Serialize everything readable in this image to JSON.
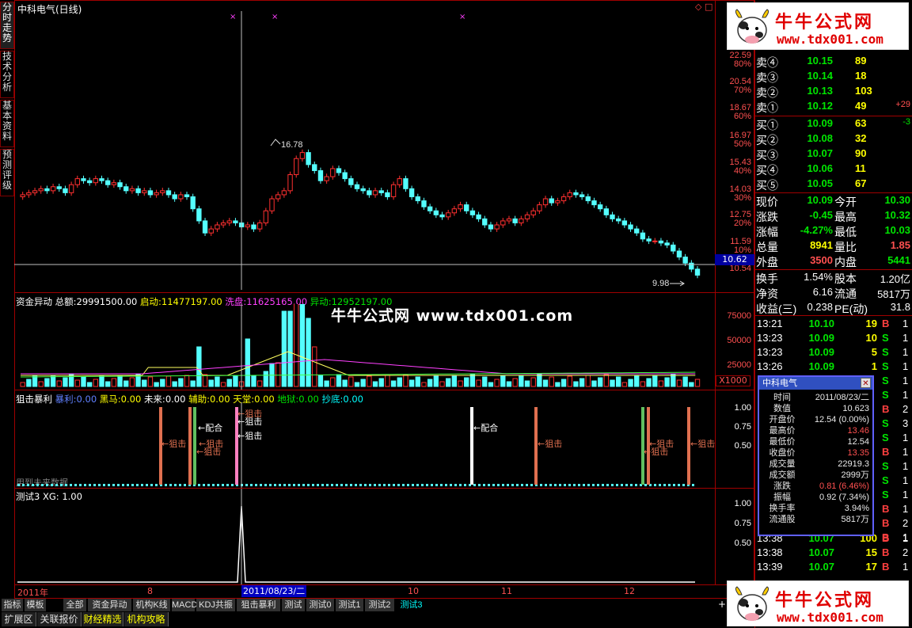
{
  "vertical_tabs": [
    "分时走势",
    "技术分析",
    "基本资料",
    "预测评级"
  ],
  "main_chart": {
    "title": "中科电气(日线)",
    "price_axis": [
      {
        "price": "22.59",
        "pct": "80%"
      },
      {
        "price": "20.54",
        "pct": "70%"
      },
      {
        "price": "18.67",
        "pct": "60%"
      },
      {
        "price": "16.97",
        "pct": "50%"
      },
      {
        "price": "15.43",
        "pct": "40%"
      },
      {
        "price": "14.03",
        "pct": "30%"
      },
      {
        "price": "12.75",
        "pct": "20%"
      },
      {
        "price": "11.59",
        "pct": "10%"
      },
      {
        "price": "10.54",
        "pct": ""
      }
    ],
    "current_price_tag": "10.62",
    "high_marker": "16.78",
    "low_marker": "9.98"
  },
  "watermark": "牛牛公式网 www.tdx001.com",
  "funds_panel": {
    "title": "资金异动",
    "total_label": "总额:",
    "total_value": "29991500.00",
    "start_label": "启动:",
    "start_value": "11477197.00",
    "wash_label": "洗盘:",
    "wash_value": "11625165.00",
    "abnormal_label": "异动:",
    "abnormal_value": "12952197.00",
    "axis": [
      "75000",
      "50000",
      "25000"
    ],
    "unit_tag": "X1000"
  },
  "snipe_panel": {
    "title": "狙击暴利",
    "items": [
      {
        "label": "暴利:",
        "value": "0.00"
      },
      {
        "label": "黑马:",
        "value": "0.00"
      },
      {
        "label": "未来:",
        "value": "0.00"
      },
      {
        "label": "辅助:",
        "value": "0.00"
      },
      {
        "label": "天堂:",
        "value": "0.00"
      },
      {
        "label": "地狱:",
        "value": "0.00"
      },
      {
        "label": "抄底:",
        "value": "0.00"
      }
    ],
    "axis": [
      "1.00",
      "0.75",
      "0.50"
    ],
    "future_text": "用到未来数据",
    "annotations": {
      "snipe": "←狙击",
      "match": "←配合"
    }
  },
  "test_panel": {
    "title": "测试3",
    "xg_label": "XG:",
    "xg_value": "1.00",
    "axis": [
      "1.00",
      "0.75",
      "0.50"
    ]
  },
  "date_axis": {
    "year": "2011年",
    "selected_date": "2011/08/23/二",
    "months": [
      "8",
      "9",
      "10",
      "11",
      "12"
    ]
  },
  "bottom_tabs": [
    "指标",
    "模板",
    "全部",
    "资金异动",
    "机构K线",
    "MACD",
    "KDJ共振",
    "狙击暴利",
    "测试",
    "测试0",
    "测试1",
    "测试2",
    "测试3"
  ],
  "bottom_plus": "+",
  "bottom2_tabs": [
    "扩展区",
    "关联报价",
    "财经精选",
    "机构攻略"
  ],
  "banner": {
    "title": "牛牛公式网",
    "url": "www.tdx001.com"
  },
  "order_book": {
    "sell": [
      {
        "label": "卖④",
        "price": "10.15",
        "vol": "89",
        "chg": ""
      },
      {
        "label": "卖③",
        "price": "10.14",
        "vol": "18",
        "chg": ""
      },
      {
        "label": "卖②",
        "price": "10.13",
        "vol": "103",
        "chg": ""
      },
      {
        "label": "卖①",
        "price": "10.12",
        "vol": "49",
        "chg": "+29"
      }
    ],
    "buy": [
      {
        "label": "买①",
        "price": "10.09",
        "vol": "63",
        "chg": "-3"
      },
      {
        "label": "买②",
        "price": "10.08",
        "vol": "32",
        "chg": ""
      },
      {
        "label": "买③",
        "price": "10.07",
        "vol": "90",
        "chg": ""
      },
      {
        "label": "买④",
        "price": "10.06",
        "vol": "11",
        "chg": ""
      },
      {
        "label": "买⑤",
        "price": "10.05",
        "vol": "67",
        "chg": ""
      }
    ]
  },
  "quote": [
    {
      "k1": "现价",
      "v1": "10.09",
      "k2": "今开",
      "v2": "10.30"
    },
    {
      "k1": "涨跌",
      "v1": "-0.45",
      "k2": "最高",
      "v2": "10.32"
    },
    {
      "k1": "涨幅",
      "v1": "-4.27%",
      "k2": "最低",
      "v2": "10.03"
    },
    {
      "k1": "总量",
      "v1": "8941",
      "k2": "量比",
      "v2": "1.85"
    },
    {
      "k1": "外盘",
      "v1": "3500",
      "k2": "内盘",
      "v2": "5441"
    }
  ],
  "fundamentals": [
    {
      "k1": "换手",
      "v1": "1.54%",
      "k2": "股本",
      "v2": "1.20亿"
    },
    {
      "k1": "净资",
      "v1": "6.16",
      "k2": "流通",
      "v2": "5817万"
    },
    {
      "k1": "收益(三)",
      "v1": "0.238",
      "k2": "PE(动)",
      "v2": "31.8"
    }
  ],
  "ticks": [
    {
      "time": "13:21",
      "price": "10.10",
      "vol": "19",
      "bs": "B",
      "n": "1"
    },
    {
      "time": "13:23",
      "price": "10.09",
      "vol": "10",
      "bs": "S",
      "n": "1"
    },
    {
      "time": "13:23",
      "price": "10.09",
      "vol": "5",
      "bs": "S",
      "n": "1"
    },
    {
      "time": "13:26",
      "price": "10.09",
      "vol": "1",
      "bs": "S",
      "n": "1"
    }
  ],
  "ticks_bottom": [
    {
      "time": "13:38",
      "price": "10.07",
      "vol": "100",
      "bs": "B",
      "n": "1"
    },
    {
      "time": "13:38",
      "price": "10.07",
      "vol": "15",
      "bs": "B",
      "n": "2"
    },
    {
      "time": "13:39",
      "price": "10.07",
      "vol": "17",
      "bs": "B",
      "n": "1"
    }
  ],
  "tick_side_letters": [
    {
      "bs": "S",
      "n": "1"
    },
    {
      "bs": "S",
      "n": "1"
    },
    {
      "bs": "B",
      "n": "2"
    },
    {
      "bs": "S",
      "n": "3"
    },
    {
      "bs": "S",
      "n": "1"
    },
    {
      "bs": "B",
      "n": "1"
    },
    {
      "bs": "S",
      "n": "1"
    },
    {
      "bs": "S",
      "n": "1"
    },
    {
      "bs": "S",
      "n": "1"
    },
    {
      "bs": "B",
      "n": "1"
    },
    {
      "bs": "B",
      "n": "2"
    },
    {
      "bs": "B",
      "n": "1"
    }
  ],
  "popup": {
    "title": "中科电气",
    "rows": [
      {
        "k": "时间",
        "v": "2011/08/23/二",
        "color": "#e8e8e8"
      },
      {
        "k": "数值",
        "v": "10.623",
        "color": "#e8e8e8"
      },
      {
        "k": "开盘价",
        "v": "12.54 (0.00%)",
        "color": "#e8e8e8"
      },
      {
        "k": "最高价",
        "v": "13.46",
        "color": "#ff5050"
      },
      {
        "k": "最低价",
        "v": "12.54",
        "color": "#e8e8e8"
      },
      {
        "k": "收盘价",
        "v": "13.35",
        "color": "#ff5050"
      },
      {
        "k": "成交量",
        "v": "22919.3",
        "color": "#e8e8e8"
      },
      {
        "k": "成交额",
        "v": "2999万",
        "color": "#e8e8e8"
      },
      {
        "k": "涨跌",
        "v": "0.81 (6.46%)",
        "color": "#ff5050"
      },
      {
        "k": "振幅",
        "v": "0.92 (7.34%)",
        "color": "#e8e8e8"
      },
      {
        "k": "换手率",
        "v": "3.94%",
        "color": "#e8e8e8"
      },
      {
        "k": "流通股",
        "v": "5817万",
        "color": "#e8e8e8"
      }
    ]
  },
  "colors": {
    "up": "#ff3030",
    "down": "#54ffff",
    "frame": "#a00000",
    "snipe": "#e07050",
    "match": "#ffffff",
    "green_bar": "#60c060",
    "pink_bar": "#ff80c0"
  }
}
